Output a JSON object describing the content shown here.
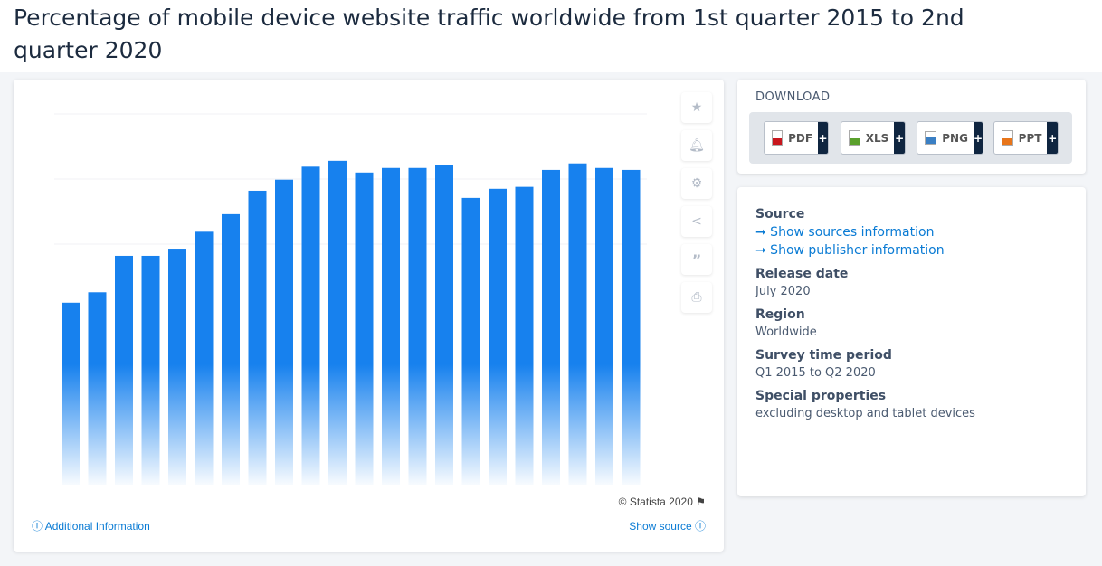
{
  "page": {
    "title": "Percentage of mobile device website traffic worldwide from 1st quarter 2015 to 2nd quarter 2020"
  },
  "chart": {
    "copyright": "© Statista 2020",
    "additional_info": "Additional Information",
    "show_source": "Show source",
    "tools": [
      "star-icon",
      "bell-icon",
      "gear-icon",
      "share-icon",
      "quote-icon",
      "print-icon"
    ]
  },
  "chart_data": {
    "type": "bar",
    "values": [
      31.0,
      32.6,
      38.2,
      38.2,
      39.3,
      41.9,
      44.6,
      48.2,
      49.9,
      51.9,
      52.8,
      51.0,
      51.7,
      51.7,
      52.2,
      47.1,
      48.5,
      48.8,
      51.4,
      52.4,
      51.7,
      51.4
    ],
    "color": "#1781ee",
    "grid": true
  },
  "download": {
    "title": "DOWNLOAD",
    "buttons": [
      {
        "label": "PDF",
        "color": "#c8161d"
      },
      {
        "label": "XLS",
        "color": "#5aa02c"
      },
      {
        "label": "PNG",
        "color": "#3a7fc4"
      },
      {
        "label": "PPT",
        "color": "#e8751a"
      }
    ],
    "plus": "+"
  },
  "info": {
    "source_label": "Source",
    "sources_link": "➞ Show sources information",
    "publisher_link": "➞ Show publisher information",
    "release_label": "Release date",
    "release_value": "July 2020",
    "region_label": "Region",
    "region_value": "Worldwide",
    "period_label": "Survey time period",
    "period_value": "Q1 2015 to Q2 2020",
    "special_label": "Special properties",
    "special_value": "excluding desktop and tablet devices"
  }
}
